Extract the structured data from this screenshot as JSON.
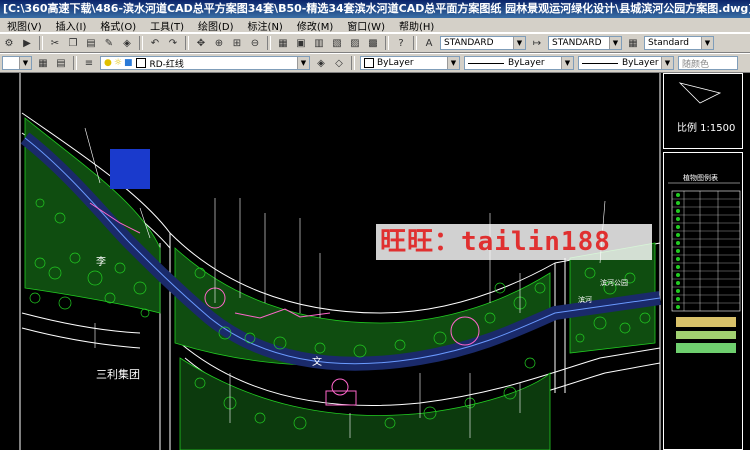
{
  "window": {
    "title": "[C:\\360高速下载\\486-滨水河道CAD总平方案图34套\\B50-精选34套滨水河道CAD总平面方案图纸 园林景观运河绿化设计\\县城滨河公园方案图.dwg]"
  },
  "menu": [
    "视图(V)",
    "插入(I)",
    "格式(O)",
    "工具(T)",
    "绘图(D)",
    "标注(N)",
    "修改(M)",
    "窗口(W)",
    "帮助(H)"
  ],
  "toolbar": {
    "text_style": "STANDARD",
    "dim_style": "STANDARD",
    "table_style": "Standard",
    "layer": "RD-红线",
    "color": "ByLayer",
    "linetype": "ByLayer",
    "lineweight": "ByLayer",
    "plotstyle": "随颜色"
  },
  "drawing": {
    "scale": "比例 1:1500",
    "legend_title": "植物图例表",
    "labels": {
      "li": "李",
      "wen": "文",
      "sanli": "三利集团",
      "river_label": "滨河",
      "park_label": "滨河公园"
    }
  },
  "watermark": "旺旺：tailin188",
  "colors": {
    "canvas": "#000000",
    "river": "#1a2a6a",
    "trees": "#22cc22",
    "lines": "#ffffff",
    "pink": "#ff66cc",
    "watermark_text": "#e03030"
  }
}
